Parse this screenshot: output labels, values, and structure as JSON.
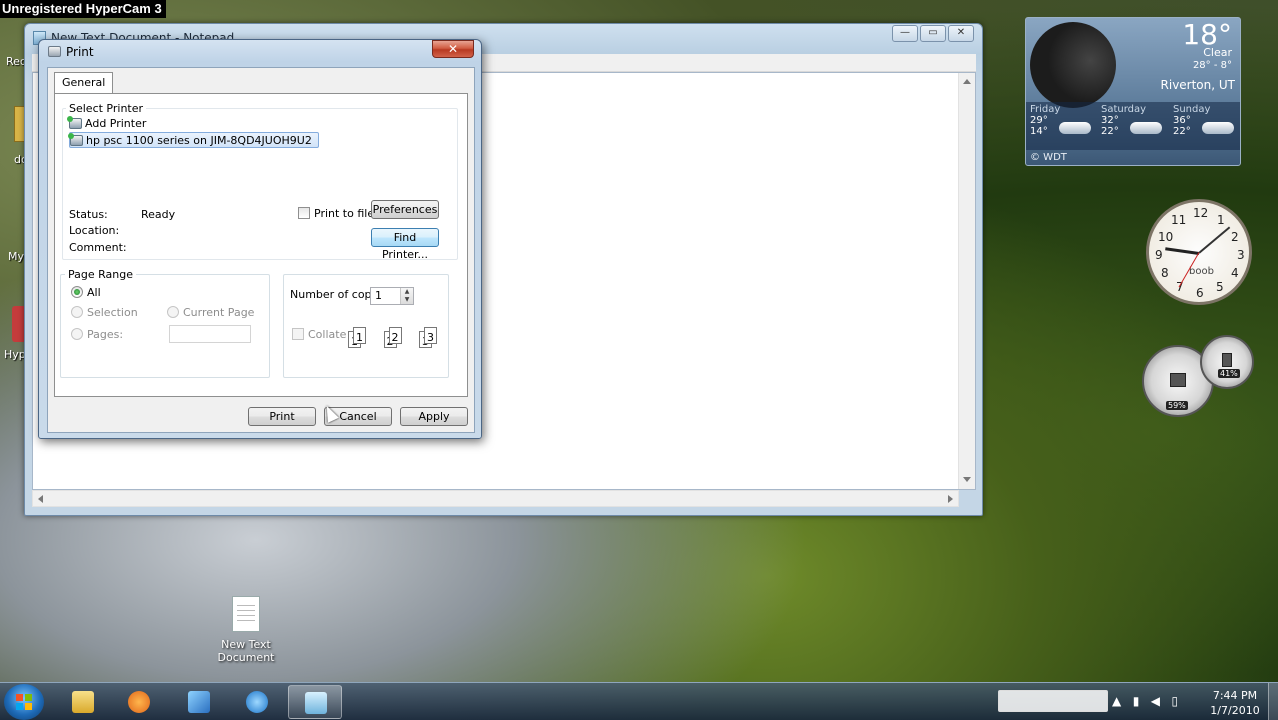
{
  "recorder": {
    "watermark": "Unregistered HyperCam 3"
  },
  "desktop": {
    "edge_labels": [
      "Rec",
      "do",
      "My",
      "Hyp"
    ],
    "icon": {
      "label_line1": "New Text",
      "label_line2": "Document",
      "icon": "text-file-icon"
    }
  },
  "notepad": {
    "title": "New Text Document - Notepad",
    "minimize": "—",
    "maximize": "▭",
    "close": "✕"
  },
  "print_dialog": {
    "title": "Print",
    "close_label": "✕",
    "tab_general": "General",
    "select_printer_label": "Select Printer",
    "printers": [
      {
        "name": "Add Printer",
        "selected": false
      },
      {
        "name": "hp psc 1100 series on JIM-8QD4JUOH9U2",
        "selected": true
      }
    ],
    "status_label": "Status:",
    "status_value": "Ready",
    "location_label": "Location:",
    "comment_label": "Comment:",
    "print_to_file_label": "Print to file",
    "preferences_label": "Preferences",
    "find_printer_label": "Find Printer...",
    "page_range_label": "Page Range",
    "range_all": "All",
    "range_selection": "Selection",
    "range_current_page": "Current Page",
    "range_pages": "Pages:",
    "pages_value": "",
    "copies_label": "Number of copies:",
    "copies_value": "1",
    "collate_label": "Collate",
    "collate_pages": [
      "1",
      "1",
      "2",
      "2",
      "3",
      "3"
    ],
    "print_button": "Print",
    "cancel_button": "Cancel",
    "apply_button": "Apply"
  },
  "weather": {
    "temp": "18°",
    "condition": "Clear",
    "range": "28° - 8°",
    "city": "Riverton, UT",
    "forecast": [
      {
        "day": "Friday",
        "high": "29°",
        "low": "14°"
      },
      {
        "day": "Saturday",
        "high": "32°",
        "low": "22°"
      },
      {
        "day": "Sunday",
        "high": "36°",
        "low": "22°"
      }
    ],
    "credit": "© WDT"
  },
  "clock": {
    "name": "boob",
    "numbers": [
      "12",
      "1",
      "2",
      "3",
      "4",
      "5",
      "6",
      "7",
      "8",
      "9",
      "10",
      "11"
    ]
  },
  "meters": {
    "cpu": "59%",
    "memory": "41%"
  },
  "taskbar": {
    "time": "7:44 PM",
    "date": "1/7/2010"
  },
  "colors": {
    "selection": "#d1e3f8",
    "focus_border": "#3c7fb1",
    "close_red": "#c7432a"
  }
}
